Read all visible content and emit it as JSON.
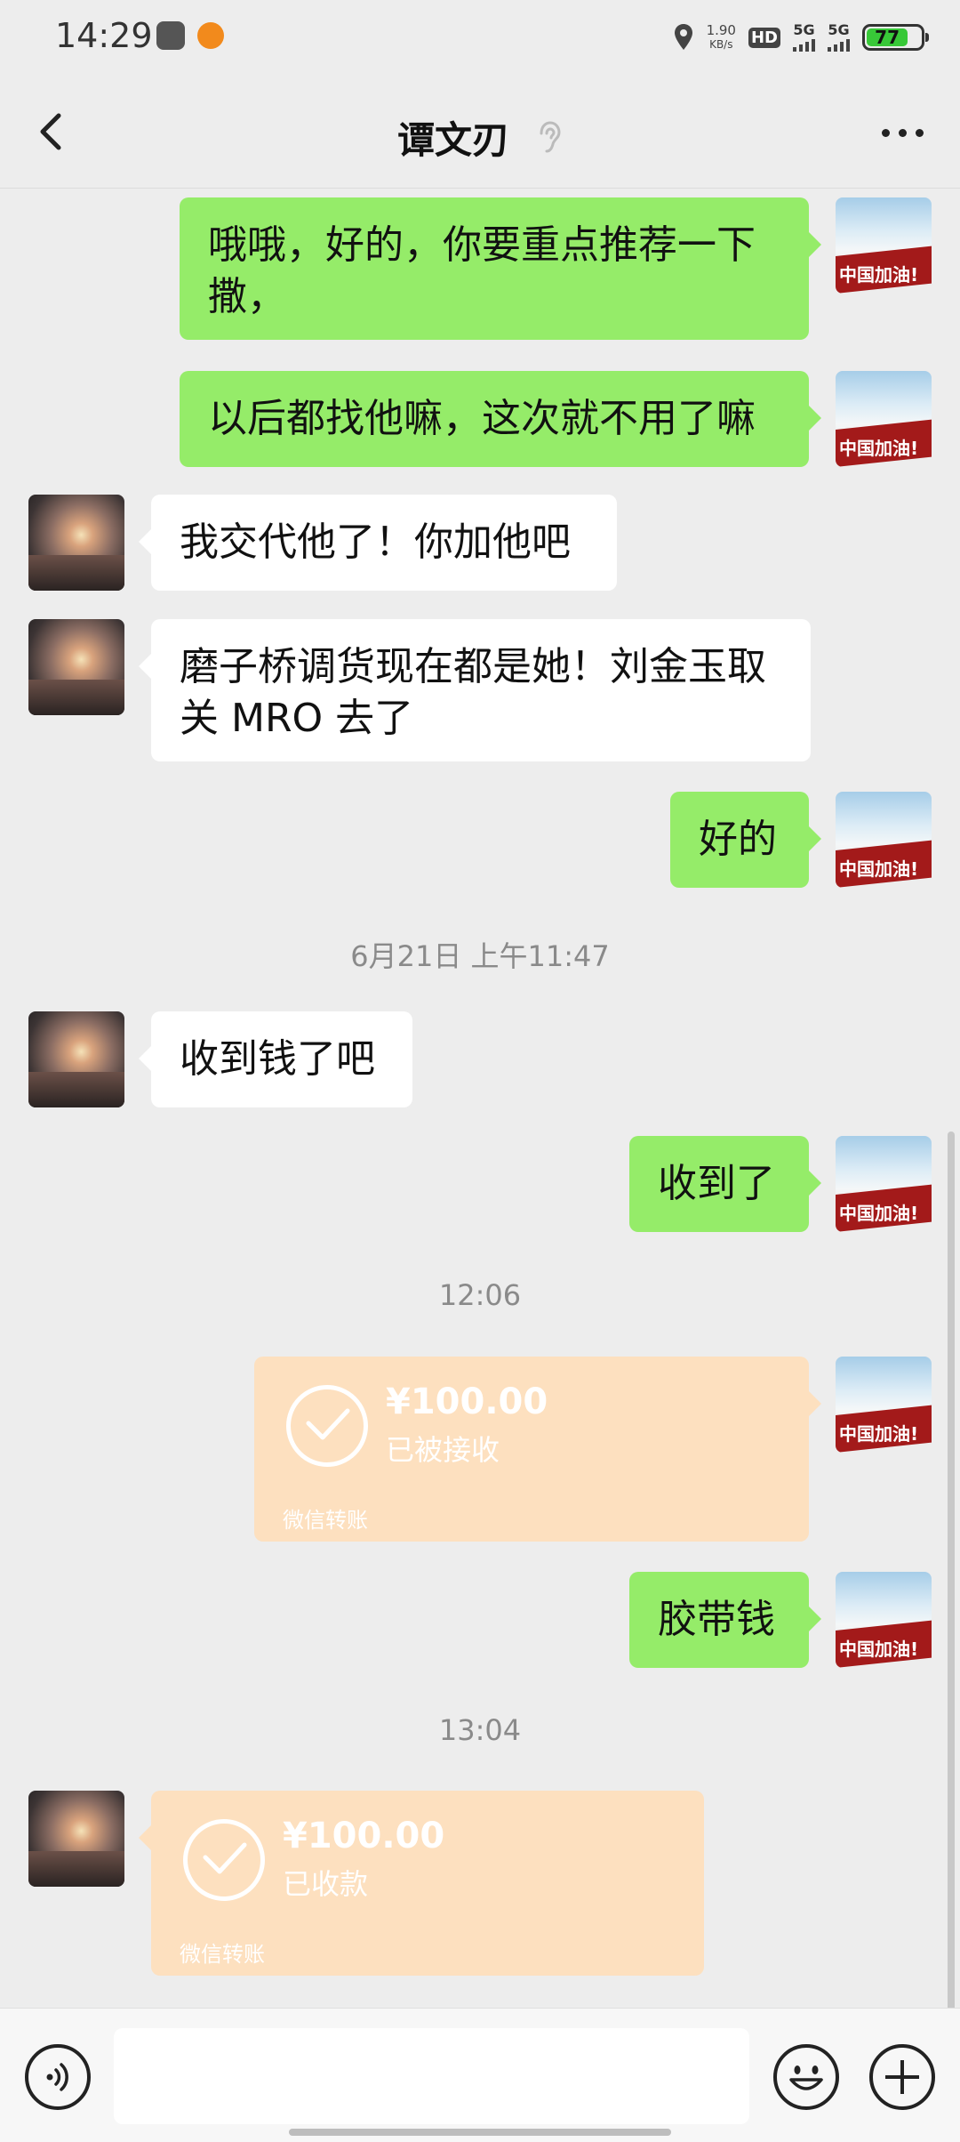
{
  "status_bar": {
    "time": "14:29",
    "net_speed_value": "1.90",
    "net_speed_unit": "KB/s",
    "hd_label": "HD",
    "sim1_label": "5G",
    "sim2_label": "5G",
    "battery_level": "77"
  },
  "header": {
    "title": "谭文刃"
  },
  "messages": [
    {
      "side": "me",
      "text": "哦哦，好的，你要重点推荐一下撒，",
      "avatar_text": "中国加油!"
    },
    {
      "side": "me",
      "text": "以后都找他嘛，这次就不用了嘛",
      "avatar_text": "中国加油!"
    },
    {
      "side": "them",
      "text": "我交代他了！你加他吧"
    },
    {
      "side": "them",
      "text": "磨子桥调货现在都是她！刘金玉取关 MRO 去了"
    },
    {
      "side": "me",
      "text": "好的",
      "avatar_text": "中国加油!"
    },
    {
      "type": "timestamp",
      "text": "6月21日 上午11:47"
    },
    {
      "side": "them",
      "text": "收到钱了吧"
    },
    {
      "side": "me",
      "text": "收到了",
      "avatar_text": "中国加油!"
    },
    {
      "type": "timestamp",
      "text": "12:06"
    },
    {
      "side": "me",
      "type": "transfer",
      "amount": "¥100.00",
      "status": "已被接收",
      "footer": "微信转账",
      "avatar_text": "中国加油!"
    },
    {
      "side": "me",
      "text": "胶带钱",
      "avatar_text": "中国加油!"
    },
    {
      "type": "timestamp",
      "text": "13:04"
    },
    {
      "side": "them",
      "type": "transfer",
      "amount": "¥100.00",
      "status": "已收款",
      "footer": "微信转账"
    }
  ],
  "colors": {
    "background": "#ededed",
    "bubble_me": "#95ec69",
    "bubble_them": "#ffffff",
    "transfer_bg": "#fde0bf",
    "timestamp": "#8a8a8a"
  },
  "icons": {
    "back": "chevron-left-icon",
    "ear": "ear-icon",
    "more": "more-dots-icon",
    "voice": "voice-icon",
    "emoji": "emoji-icon",
    "plus": "plus-icon"
  }
}
